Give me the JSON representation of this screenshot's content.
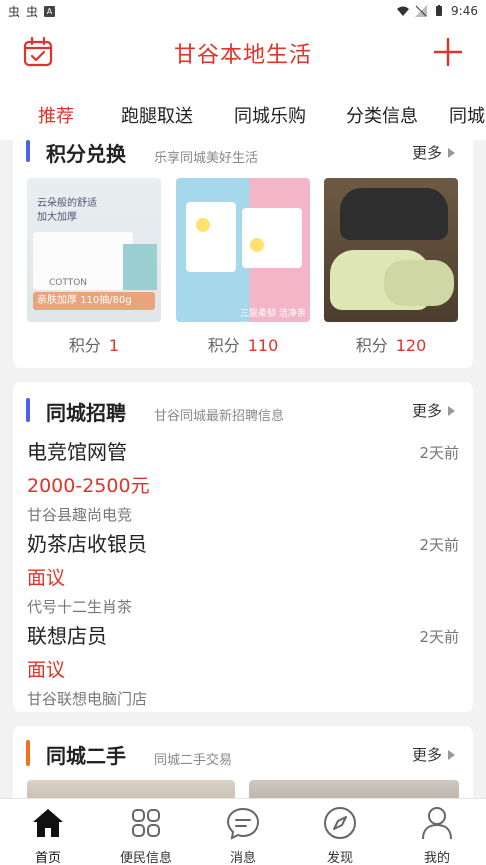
{
  "status_bar": {
    "left_glyphs": [
      "虫",
      "虫"
    ],
    "time": "9:46"
  },
  "header": {
    "title": "甘谷本地生活"
  },
  "tabs": [
    "推荐",
    "跑腿取送",
    "同城乐购",
    "分类信息",
    "同城"
  ],
  "points": {
    "title": "积分兑换",
    "subtitle": "乐享同城美好生活",
    "more": "更多",
    "items": [
      {
        "label": "积分",
        "value": "1",
        "img_text_1": "云朵般的舒适",
        "img_text_2": "加大加厚",
        "img_text_3": "亲肤加厚",
        "img_text_4": "110抽/80g",
        "img_text_5": "COTTON"
      },
      {
        "label": "积分",
        "value": "110",
        "img_text_1": "三层柔韧 洁净亲肤"
      },
      {
        "label": "积分",
        "value": "120"
      }
    ]
  },
  "jobs": {
    "title": "同城招聘",
    "subtitle": "甘谷同城最新招聘信息",
    "more": "更多",
    "items": [
      {
        "title": "电竞馆网管",
        "salary": "2000-2500元",
        "company": "甘谷县趣尚电竞",
        "time": "2天前"
      },
      {
        "title": "奶茶店收银员",
        "salary": "面议",
        "company": "代号十二生肖茶",
        "time": "2天前"
      },
      {
        "title": "联想店员",
        "salary": "面议",
        "company": "甘谷联想电脑门店",
        "time": "2天前"
      }
    ]
  },
  "secondhand": {
    "title": "同城二手",
    "subtitle": "同城二手交易",
    "more": "更多"
  },
  "bottom_nav": [
    {
      "label": "首页",
      "icon": "home-icon"
    },
    {
      "label": "便民信息",
      "icon": "grid-icon"
    },
    {
      "label": "消息",
      "icon": "message-icon"
    },
    {
      "label": "发现",
      "icon": "compass-icon"
    },
    {
      "label": "我的",
      "icon": "user-icon"
    }
  ],
  "colors": {
    "accent": "#e2332b",
    "bar_blue": "#4a62e8",
    "bar_orange": "#f2711c"
  }
}
